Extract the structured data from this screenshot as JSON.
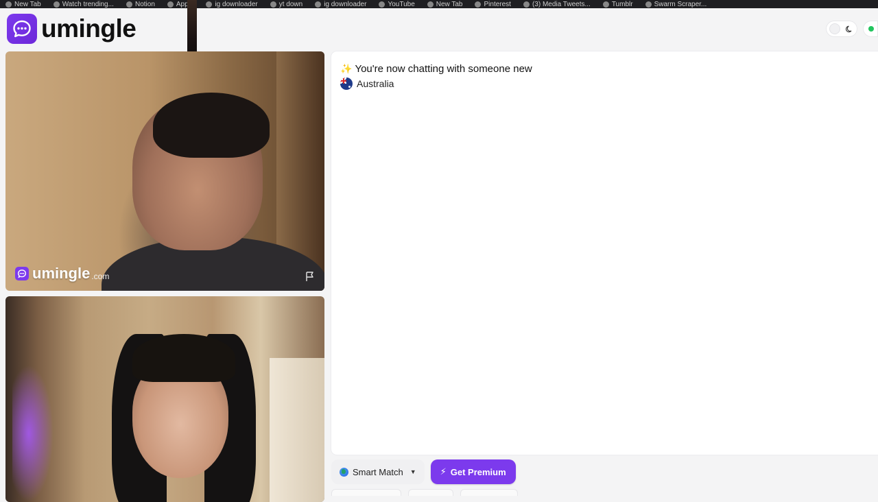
{
  "browser": {
    "bookmarks": [
      "New Tab",
      "Watch trending...",
      "",
      "Notion",
      "Apple",
      "ig downloader",
      "yt down",
      "ig downloader",
      "YouTube",
      "New Tab",
      "Pinterest",
      "(3) Media Tweets...",
      "Tumblr",
      "Swarm Scraper..."
    ]
  },
  "header": {
    "logo_text": "umingle"
  },
  "remote_video": {
    "watermark_text": "umingle",
    "watermark_tld": ".com",
    "report_icon": "flag-icon"
  },
  "chat": {
    "notice_icon": "sparkle-icon",
    "notice_text": "You're now chatting with someone new",
    "country_name": "Australia",
    "country_flag_icon": "australia-flag-icon"
  },
  "controls": {
    "match_label": "Smart Match",
    "match_icon": "globe-icon",
    "premium_label": "Get Premium",
    "premium_icon": "bolt-icon"
  },
  "colors": {
    "brand": "#7c3aed",
    "online": "#22c55e"
  }
}
